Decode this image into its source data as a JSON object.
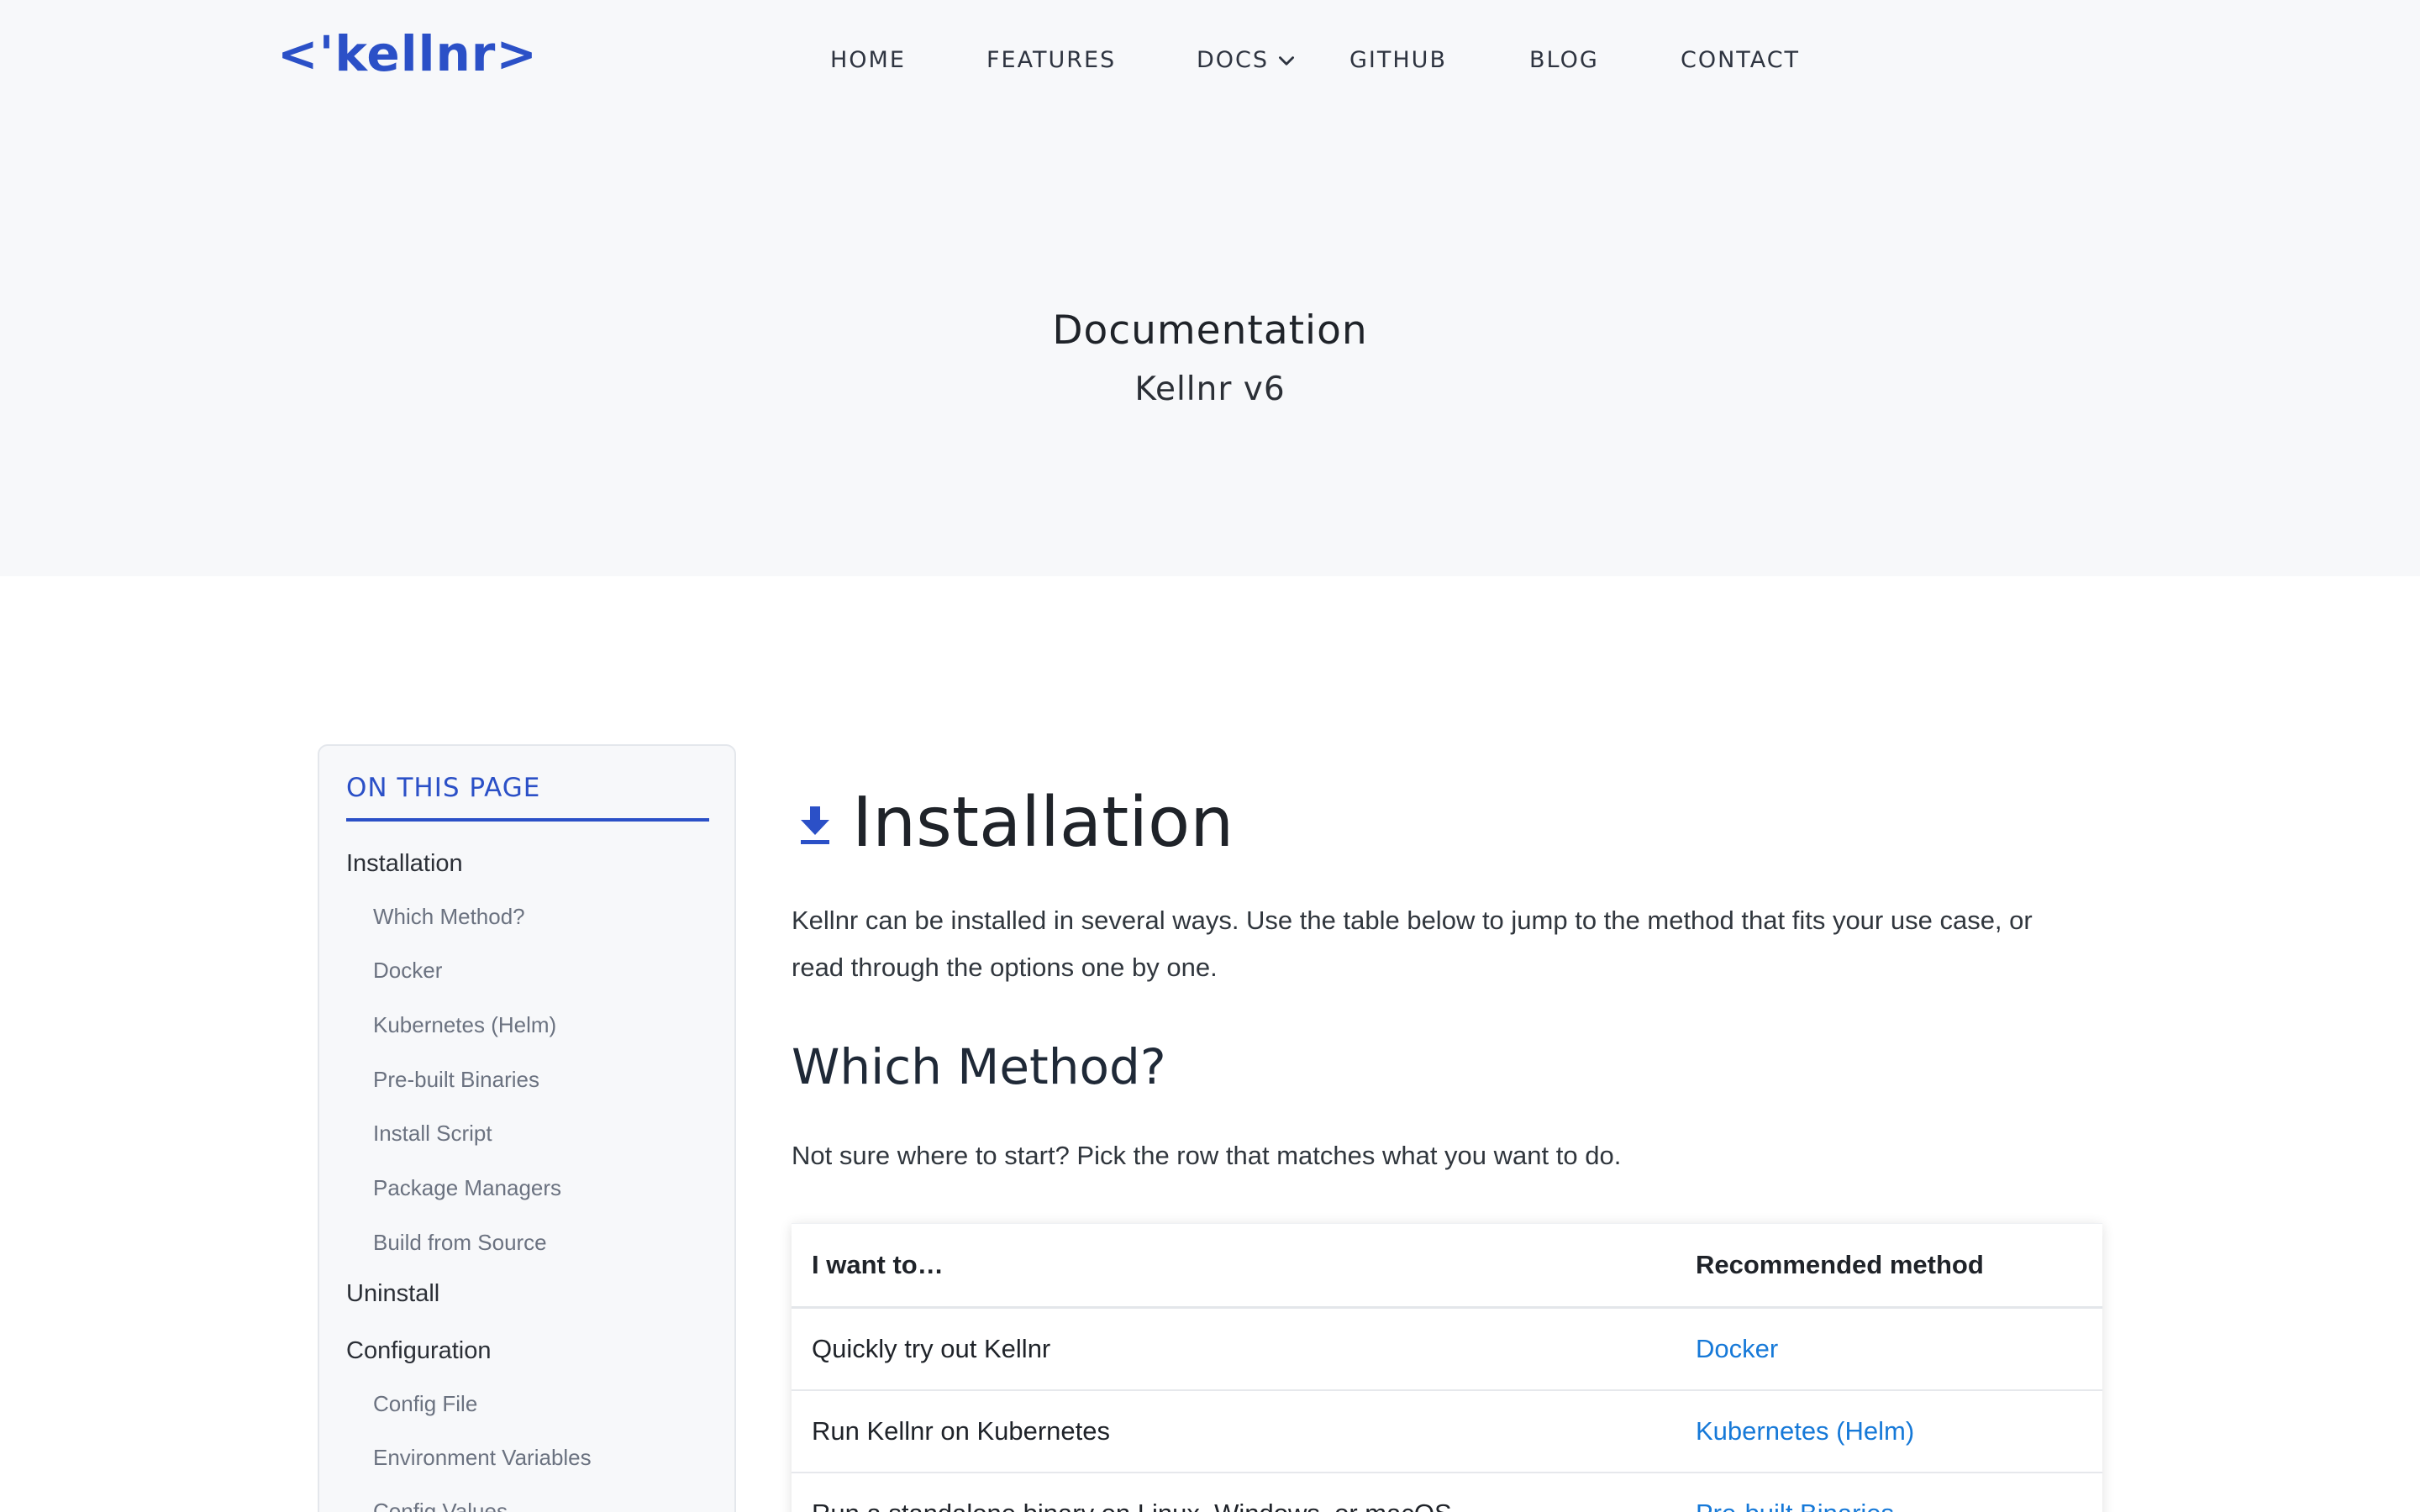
{
  "header": {
    "logo": "<'kellnr>",
    "nav": [
      {
        "label": "HOME"
      },
      {
        "label": "FEATURES"
      },
      {
        "label": "DOCS",
        "has_dropdown": true
      },
      {
        "label": "GITHUB"
      },
      {
        "label": "BLOG"
      },
      {
        "label": "CONTACT"
      }
    ]
  },
  "hero": {
    "title": "Documentation",
    "subtitle": "Kellnr v6"
  },
  "toc": {
    "title": "ON THIS PAGE",
    "items": [
      {
        "label": "Installation",
        "level": 1
      },
      {
        "label": "Which Method?",
        "level": 2
      },
      {
        "label": "Docker",
        "level": 2
      },
      {
        "label": "Kubernetes (Helm)",
        "level": 2
      },
      {
        "label": "Pre-built Binaries",
        "level": 2
      },
      {
        "label": "Install Script",
        "level": 2
      },
      {
        "label": "Package Managers",
        "level": 2
      },
      {
        "label": "Build from Source",
        "level": 2
      },
      {
        "label": "Uninstall",
        "level": 1
      },
      {
        "label": "Configuration",
        "level": 1
      },
      {
        "label": "Config File",
        "level": 2
      },
      {
        "label": "Environment Variables",
        "level": 2
      },
      {
        "label": "Config Values",
        "level": 2
      }
    ]
  },
  "content": {
    "title_icon": "download-icon",
    "title": "Installation",
    "intro_line1": "Kellnr can be installed in several ways. Use the table below to jump to the method that fits your use case, or",
    "intro_line2": "read through the options one by one.",
    "section_title": "Which Method?",
    "section_lead": "Not sure where to start? Pick the row that matches what you want to do.",
    "table": {
      "headers": [
        "I want to…",
        "Recommended method"
      ],
      "rows": [
        {
          "want": "Quickly try out Kellnr",
          "method": "Docker"
        },
        {
          "want": "Run Kellnr on Kubernetes",
          "method": "Kubernetes (Helm)"
        },
        {
          "want": "Run a standalone binary on Linux, Windows, or macOS",
          "method": "Pre-built Binaries"
        }
      ]
    }
  },
  "colors": {
    "brand": "#2b50c7",
    "link": "#1679d8",
    "hero_bg": "#f7f8fa"
  }
}
